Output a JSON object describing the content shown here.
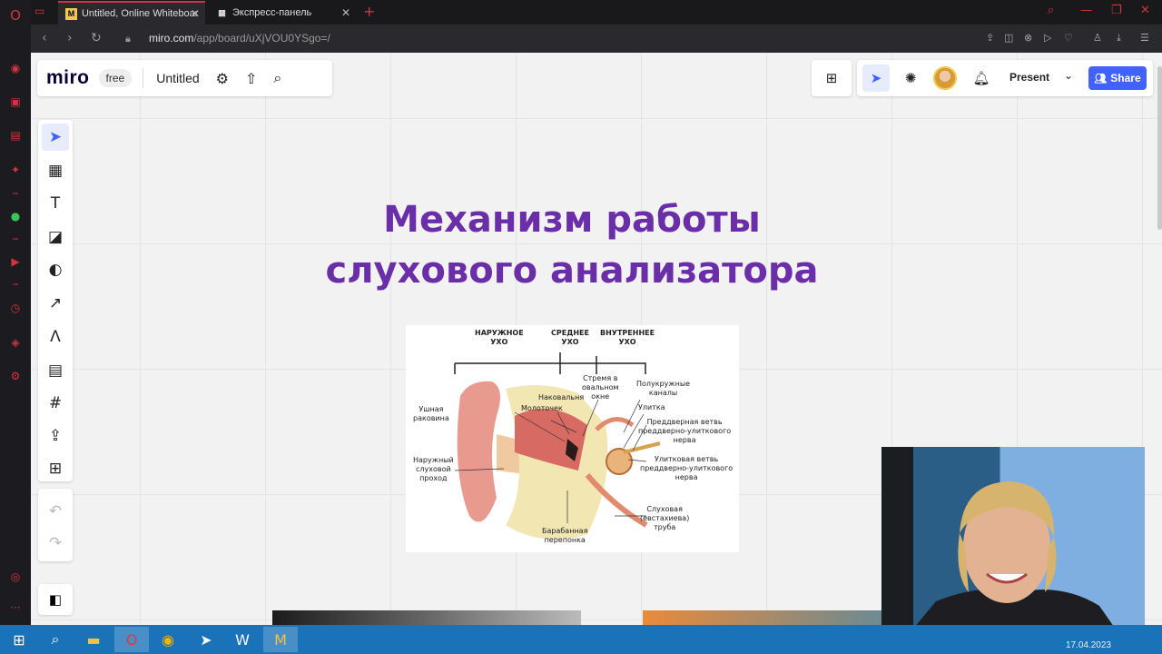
{
  "browser": {
    "tabs": [
      {
        "title": "Untitled, Online Whiteboar",
        "favicon": "miro-favicon",
        "active": true
      },
      {
        "title": "Экспресс-панель",
        "favicon": "grid-icon",
        "active": false
      }
    ],
    "new_tab_glyph": "+",
    "url_host": "miro.com",
    "url_path": "/app/board/uXjVOU0YSgo=/",
    "accent": "#d0353d"
  },
  "miro": {
    "logo": "miro",
    "plan_badge": "free",
    "board_title": "Untitled",
    "present_label": "Present",
    "share_label": "Share",
    "accent": "#4262ff"
  },
  "slide": {
    "title_line1": "Механизм работы",
    "title_line2": "слухового анализатора",
    "title_color": "#6a2fa8"
  },
  "ear_diagram": {
    "header_outer": "НАРУЖНОЕ\nУХО",
    "header_middle": "СРЕДНЕЕ\nУХО",
    "header_inner": "ВНУТРЕННЕЕ\nУХО",
    "labels": {
      "auricle": "Ушная\nраковина",
      "canal": "Наружный\nслуховой\nпроход",
      "malleus": "Молоточек",
      "incus": "Наковальня",
      "stapes": "Стремя в\nовальном\nокне",
      "canals": "Полукружные\nканалы",
      "cochlea": "Улитка",
      "vestibular": "Преддверная ветвь\nпреддверно-улиткового\nнерва",
      "cochlear_branch": "Улитковая ветвь\nпреддверно-улиткового\nнерва",
      "tube": "Слуховая\n(евстахиева)\nтруба",
      "eardrum": "Барабанная\nперепонка"
    }
  },
  "taskbar": {
    "date": "17.04.2023"
  }
}
